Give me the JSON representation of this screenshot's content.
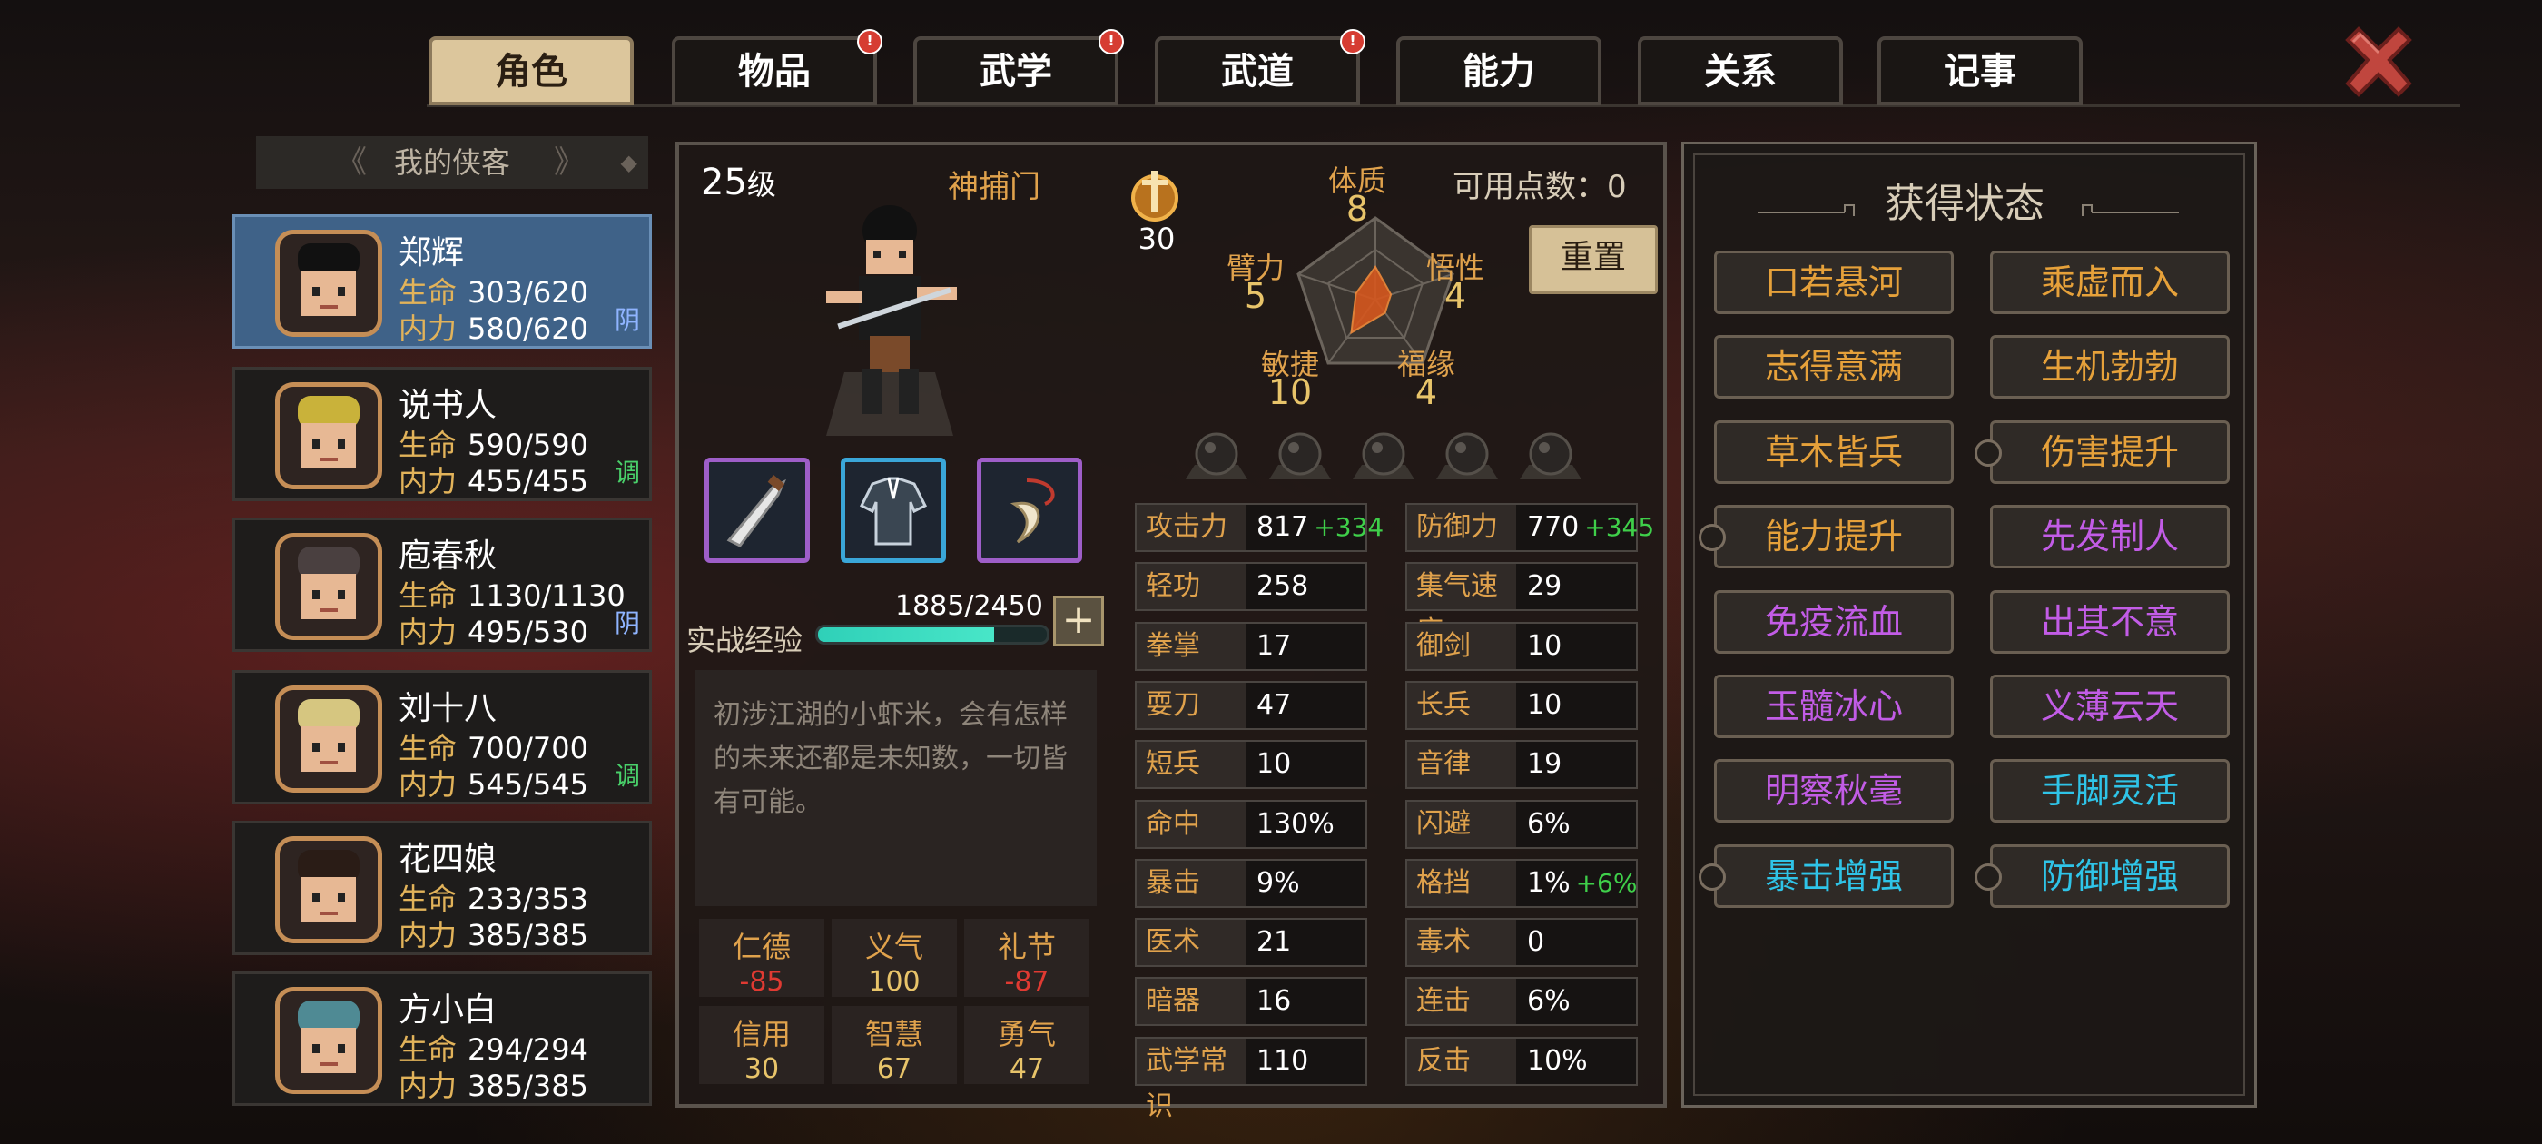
{
  "tabs": [
    {
      "label": "角色",
      "active": true,
      "alert": false
    },
    {
      "label": "物品",
      "active": false,
      "alert": true
    },
    {
      "label": "武学",
      "active": false,
      "alert": true
    },
    {
      "label": "武道",
      "active": false,
      "alert": true
    },
    {
      "label": "能力",
      "active": false,
      "alert": false
    },
    {
      "label": "关系",
      "active": false,
      "alert": false
    },
    {
      "label": "记事",
      "active": false,
      "alert": false
    }
  ],
  "alert_mark": "!",
  "roster": {
    "header": "我的侠客",
    "hp_label": "生命",
    "mp_label": "内力",
    "members": [
      {
        "name": "郑辉",
        "hp": "303/620",
        "mp": "580/620",
        "tag": "阴",
        "tag_color": "#8fb4ff"
      },
      {
        "name": "说书人",
        "hp": "590/590",
        "mp": "455/455",
        "tag": "调",
        "tag_color": "#49d06a"
      },
      {
        "name": "庖春秋",
        "hp": "1130/1130",
        "mp": "495/530",
        "tag": "阴",
        "tag_color": "#8fb4ff"
      },
      {
        "name": "刘十八",
        "hp": "700/700",
        "mp": "545/545",
        "tag": "调",
        "tag_color": "#49d06a"
      },
      {
        "name": "花四娘",
        "hp": "233/353",
        "mp": "385/385",
        "tag": "",
        "tag_color": "#ffffff"
      },
      {
        "name": "方小白",
        "hp": "294/294",
        "mp": "385/385",
        "tag": "",
        "tag_color": "#ffffff"
      }
    ]
  },
  "character": {
    "level": "25",
    "level_unit": "级",
    "sect": "神捕门",
    "reputation": "30",
    "points_label": "可用点数：",
    "points": "0",
    "reset_label": "重置",
    "attributes": [
      {
        "name": "体质",
        "value": "8"
      },
      {
        "name": "悟性",
        "value": "4"
      },
      {
        "name": "福缘",
        "value": "4"
      },
      {
        "name": "敏捷",
        "value": "10"
      },
      {
        "name": "臂力",
        "value": "5"
      }
    ],
    "equipment": [
      "blade-icon",
      "robe-icon",
      "horn-pendant-icon"
    ],
    "exp_label": "实战经验",
    "exp_value": "1885/2450",
    "exp_fraction": 0.769,
    "description": "初涉江湖的小虾米，会有怎样的未来还都是未知数，一切皆有可能。",
    "virtues": [
      {
        "name": "仁德",
        "value": "-85",
        "color": "#e03a32"
      },
      {
        "name": "义气",
        "value": "100",
        "color": "#e8c46a"
      },
      {
        "name": "礼节",
        "value": "-87",
        "color": "#e03a32"
      },
      {
        "name": "信用",
        "value": "30",
        "color": "#e8c46a"
      },
      {
        "name": "智慧",
        "value": "67",
        "color": "#e8c46a"
      },
      {
        "name": "勇气",
        "value": "47",
        "color": "#e8c46a"
      }
    ]
  },
  "stats_left": [
    {
      "name": "攻击力",
      "value": "817",
      "bonus": "+334"
    },
    {
      "name": "轻功",
      "value": "258",
      "bonus": ""
    },
    {
      "name": "拳掌",
      "value": "17",
      "bonus": ""
    },
    {
      "name": "耍刀",
      "value": "47",
      "bonus": ""
    },
    {
      "name": "短兵",
      "value": "10",
      "bonus": ""
    },
    {
      "name": "命中",
      "value": "130%",
      "bonus": ""
    },
    {
      "name": "暴击",
      "value": "9%",
      "bonus": ""
    },
    {
      "name": "医术",
      "value": "21",
      "bonus": ""
    },
    {
      "name": "暗器",
      "value": "16",
      "bonus": ""
    },
    {
      "name": "武学常识",
      "value": "110",
      "bonus": ""
    }
  ],
  "stats_right": [
    {
      "name": "防御力",
      "value": "770",
      "bonus": "+345"
    },
    {
      "name": "集气速度",
      "value": "29",
      "bonus": ""
    },
    {
      "name": "御剑",
      "value": "10",
      "bonus": ""
    },
    {
      "name": "长兵",
      "value": "10",
      "bonus": ""
    },
    {
      "name": "音律",
      "value": "19",
      "bonus": ""
    },
    {
      "name": "闪避",
      "value": "6%",
      "bonus": ""
    },
    {
      "name": "格挡",
      "value": "1%",
      "bonus": "+6%"
    },
    {
      "name": "毒术",
      "value": "0",
      "bonus": ""
    },
    {
      "name": "连击",
      "value": "6%",
      "bonus": ""
    },
    {
      "name": "反击",
      "value": "10%",
      "bonus": ""
    }
  ],
  "status": {
    "title": "获得状态",
    "buffs": [
      {
        "label": "口若悬河",
        "color": "#e6a13a",
        "timed": false
      },
      {
        "label": "乘虚而入",
        "color": "#e6a13a",
        "timed": false
      },
      {
        "label": "志得意满",
        "color": "#e6a13a",
        "timed": false
      },
      {
        "label": "生机勃勃",
        "color": "#e6a13a",
        "timed": false
      },
      {
        "label": "草木皆兵",
        "color": "#e6a13a",
        "timed": false
      },
      {
        "label": "伤害提升",
        "color": "#e6a13a",
        "timed": true
      },
      {
        "label": "能力提升",
        "color": "#e6a13a",
        "timed": true
      },
      {
        "label": "先发制人",
        "color": "#c25ce6",
        "timed": false
      },
      {
        "label": "免疫流血",
        "color": "#c25ce6",
        "timed": false
      },
      {
        "label": "出其不意",
        "color": "#c25ce6",
        "timed": false
      },
      {
        "label": "玉髓冰心",
        "color": "#c25ce6",
        "timed": false
      },
      {
        "label": "义薄云天",
        "color": "#c25ce6",
        "timed": false
      },
      {
        "label": "明察秋毫",
        "color": "#c25ce6",
        "timed": false
      },
      {
        "label": "手脚灵活",
        "color": "#2fc4e8",
        "timed": false
      },
      {
        "label": "暴击增强",
        "color": "#2fc4e8",
        "timed": true
      },
      {
        "label": "防御增强",
        "color": "#2fc4e8",
        "timed": true
      }
    ]
  }
}
